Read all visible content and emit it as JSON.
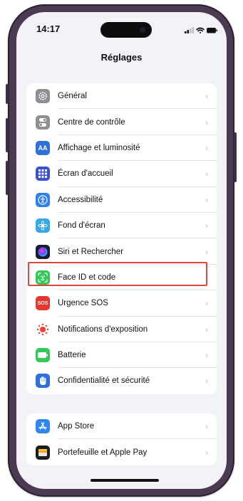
{
  "status": {
    "time": "14:17"
  },
  "header": {
    "title": "Réglages"
  },
  "groups": [
    {
      "items": [
        {
          "label": "Général",
          "icon": "gear-icon",
          "color": "#8e8e93"
        },
        {
          "label": "Centre de contrôle",
          "icon": "toggles-icon",
          "color": "#8e8e93"
        },
        {
          "label": "Affichage et luminosité",
          "icon": "text-size-icon",
          "color": "#2f6fdb",
          "glyph": "AA"
        },
        {
          "label": "Écran d'accueil",
          "icon": "app-grid-icon",
          "color": "#3a52d1"
        },
        {
          "label": "Accessibilité",
          "icon": "accessibility-icon",
          "color": "#2f7ff0"
        },
        {
          "label": "Fond d'écran",
          "icon": "flower-icon",
          "color": "#35a8e8"
        },
        {
          "label": "Siri et Rechercher",
          "icon": "siri-icon",
          "color": "#1b1b2e"
        },
        {
          "label": "Face ID et code",
          "icon": "face-id-icon",
          "color": "#34c759",
          "highlighted": true
        },
        {
          "label": "Urgence SOS",
          "icon": "sos-icon",
          "color": "#e5372f",
          "glyph": "SOS"
        },
        {
          "label": "Notifications d'exposition",
          "icon": "exposure-icon",
          "color": "#ffffff"
        },
        {
          "label": "Batterie",
          "icon": "battery-icon",
          "color": "#34c759"
        },
        {
          "label": "Confidentialité et sécurité",
          "icon": "hand-icon",
          "color": "#2f6fdb"
        }
      ]
    },
    {
      "items": [
        {
          "label": "App Store",
          "icon": "app-store-icon",
          "color": "#2f86f0"
        },
        {
          "label": "Portefeuille et Apple Pay",
          "icon": "wallet-icon",
          "color": "#1c1c1e"
        }
      ]
    }
  ],
  "colors": {
    "highlight": "#e2453c",
    "background": "#f2f2f7",
    "frame": "#4b3a52"
  }
}
